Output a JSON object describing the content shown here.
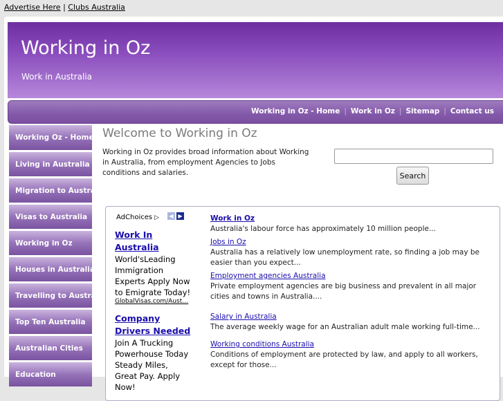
{
  "topbar": {
    "advertise": "Advertise Here",
    "separator": "|",
    "clubs": "Clubs Australia"
  },
  "header": {
    "title": "Working in Oz",
    "subtitle": "Work in Australia"
  },
  "nav": {
    "items": [
      "Working in Oz - Home",
      "Work in Oz",
      "Sitemap",
      "Contact us"
    ]
  },
  "sidebar": {
    "items": [
      "Working Oz - Home",
      "Living in Australia",
      "Migration to Australia",
      "Visas to Australia",
      "Working in Oz",
      "Houses in Australia",
      "Travelling to Australia",
      "Top Ten Australia",
      "Australian Cities",
      "Education"
    ]
  },
  "content": {
    "heading": "Welcome to Working in Oz",
    "intro": "Working in Oz provides broad information about Working in Australia, from employment Agencies to Jobs conditions and salaries.",
    "search": {
      "value": "",
      "button": "Search"
    }
  },
  "ads": {
    "adchoices": "AdChoices",
    "items": [
      {
        "title": "Work In Australia",
        "body": "World'sLeading Immigration Experts Apply Now to Emigrate Today!",
        "url": "GlobalVisas.com/Aust…"
      },
      {
        "title": "Company Drivers Needed",
        "body": "Join A Trucking Powerhouse Today Steady Miles, Great Pay. Apply Now!",
        "url": ""
      }
    ]
  },
  "links": [
    {
      "title": "Work in Oz",
      "desc": "Australia's labour force has approximately 10 million people..."
    },
    {
      "title": "Jobs in Oz",
      "desc": "Australia has a relatively low unemployment rate, so finding a job may be easier than you expect..."
    },
    {
      "title": "Employment agencies Australia",
      "desc": "Private employment agencies are big business and prevalent in all major cities and towns in Australia...."
    },
    {
      "title": "Salary in Australia",
      "desc": "The average weekly wage for an Australian adult male working full-time..."
    },
    {
      "title": "Working conditions Australia",
      "desc": "Conditions of employment are protected by law, and apply to all workers, except for those..."
    }
  ],
  "colors": {
    "header": "#7a3cb0",
    "nav": "#8359a9",
    "link": "#1a0dab"
  }
}
